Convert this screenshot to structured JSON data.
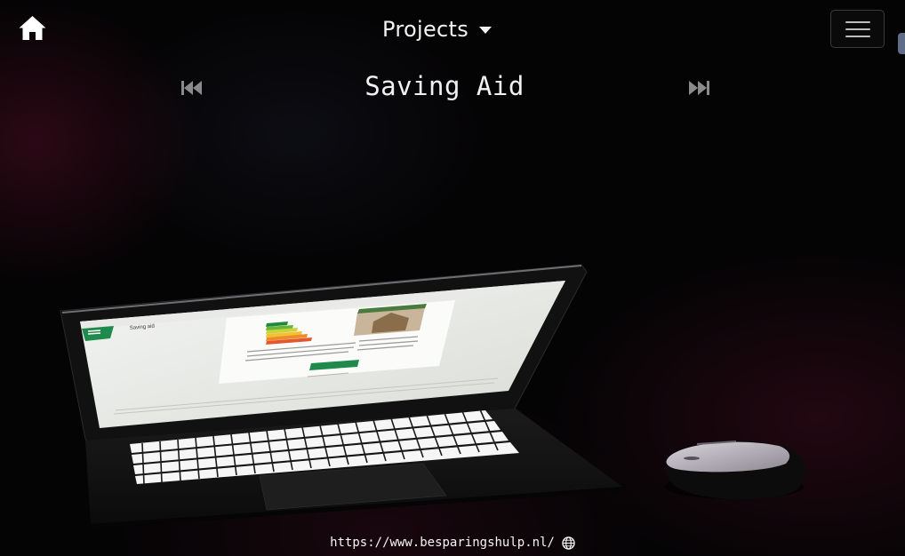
{
  "header": {
    "home_icon": "home-icon",
    "projects_label": "Projects",
    "dropdown_icon": "caret-down-icon",
    "menu_icon": "hamburger-menu-icon"
  },
  "project_nav": {
    "prev_icon": "skip-previous-icon",
    "next_icon": "skip-next-icon",
    "title": "Saving Aid"
  },
  "scene": {
    "description": "3D laptop showing website with mouse",
    "screen_site_name": "Saving aid",
    "colors": {
      "site_green": "#1f8a4c",
      "energy_label": [
        "#1f8a3a",
        "#6cb33a",
        "#c8d43a",
        "#f1c232",
        "#ee8a2c",
        "#e4572c",
        "#c7282b"
      ]
    }
  },
  "footer": {
    "url": "https://www.besparingshulp.nl/",
    "link_icon": "globe-icon"
  }
}
